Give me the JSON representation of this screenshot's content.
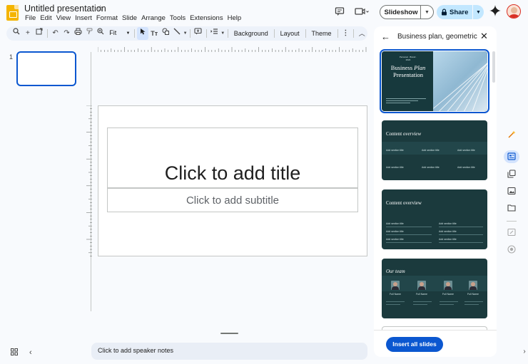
{
  "header": {
    "doc_title": "Untitled presentation",
    "menu": [
      "File",
      "Edit",
      "View",
      "Insert",
      "Format",
      "Slide",
      "Arrange",
      "Tools",
      "Extensions",
      "Help"
    ],
    "slideshow_label": "Slideshow",
    "share_label": "Share"
  },
  "toolbar": {
    "zoom_value": "Fit",
    "background_label": "Background",
    "layout_label": "Layout",
    "theme_label": "Theme"
  },
  "filmstrip": {
    "slide_number": "1"
  },
  "slide": {
    "title_placeholder": "Click to add title",
    "subtitle_placeholder": "Click to add subtitle"
  },
  "notes": {
    "placeholder": "Click to add speaker notes"
  },
  "panel": {
    "title": "Business plan, geometric",
    "insert_label": "Insert all slides",
    "templates": {
      "t1": {
        "small": "Personal · Brand · 2024",
        "title_1": "Business",
        "title_em": "Plan",
        "title_2": "Presentation"
      },
      "t2": {
        "heading": "Content",
        "heading_em": "overview",
        "item": "Add section title"
      },
      "t3": {
        "heading": "Content overview",
        "item": "Add section title"
      },
      "t4": {
        "heading": "Our team",
        "names": [
          "Full Name",
          "Full Name",
          "Full Name",
          "Full Name"
        ]
      }
    }
  },
  "colors": {
    "accent": "#0b57d0",
    "share_bg": "#c2e7ff",
    "template_bg": "#1b3a3d"
  }
}
